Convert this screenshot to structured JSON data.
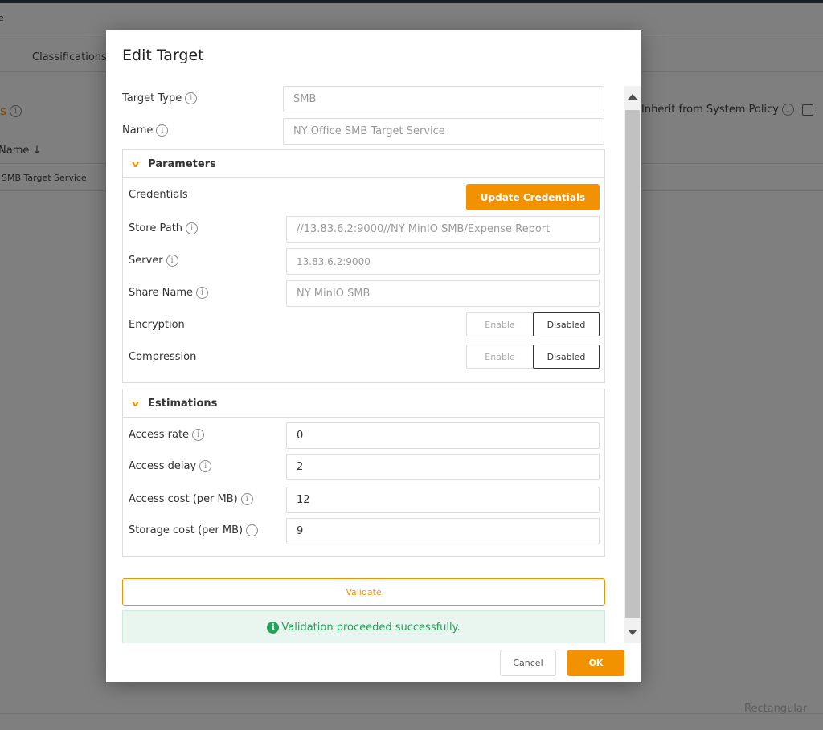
{
  "background": {
    "top_text": "e",
    "tab_classifications": "Classifications",
    "section_suffix": "s",
    "inherit_label": "Inherit from System Policy",
    "col_name": "Name ↓",
    "row_name": "SMB Target Service",
    "bottom_right": "Rectangular"
  },
  "modal": {
    "title": "Edit Target",
    "fields": {
      "target_type": {
        "label": "Target Type",
        "value": "SMB"
      },
      "name": {
        "label": "Name",
        "value": "NY Office SMB Target Service"
      }
    },
    "parameters": {
      "header": "Parameters",
      "credentials_label": "Credentials",
      "update_credentials": "Update Credentials",
      "store_path": {
        "label": "Store Path",
        "value": "//13.83.6.2:9000//NY MinIO SMB/Expense Report"
      },
      "server": {
        "label": "Server",
        "value": "13.83.6.2:9000"
      },
      "share_name": {
        "label": "Share Name",
        "value": "NY MinIO SMB"
      },
      "encryption": {
        "label": "Encryption",
        "enable": "Enable",
        "disabled": "Disabled"
      },
      "compression": {
        "label": "Compression",
        "enable": "Enable",
        "disabled": "Disabled"
      }
    },
    "estimations": {
      "header": "Estimations",
      "access_rate": {
        "label": "Access rate",
        "value": "0"
      },
      "access_delay": {
        "label": "Access delay",
        "value": "2"
      },
      "access_cost": {
        "label": "Access cost (per MB)",
        "value": "12"
      },
      "storage_cost": {
        "label": "Storage cost (per MB)",
        "value": "9"
      }
    },
    "validate_label": "Validate",
    "success_message": "Validation proceeded successfully.",
    "cancel_label": "Cancel",
    "ok_label": "OK"
  },
  "colors": {
    "accent": "#f39200",
    "success": "#27a05a"
  }
}
